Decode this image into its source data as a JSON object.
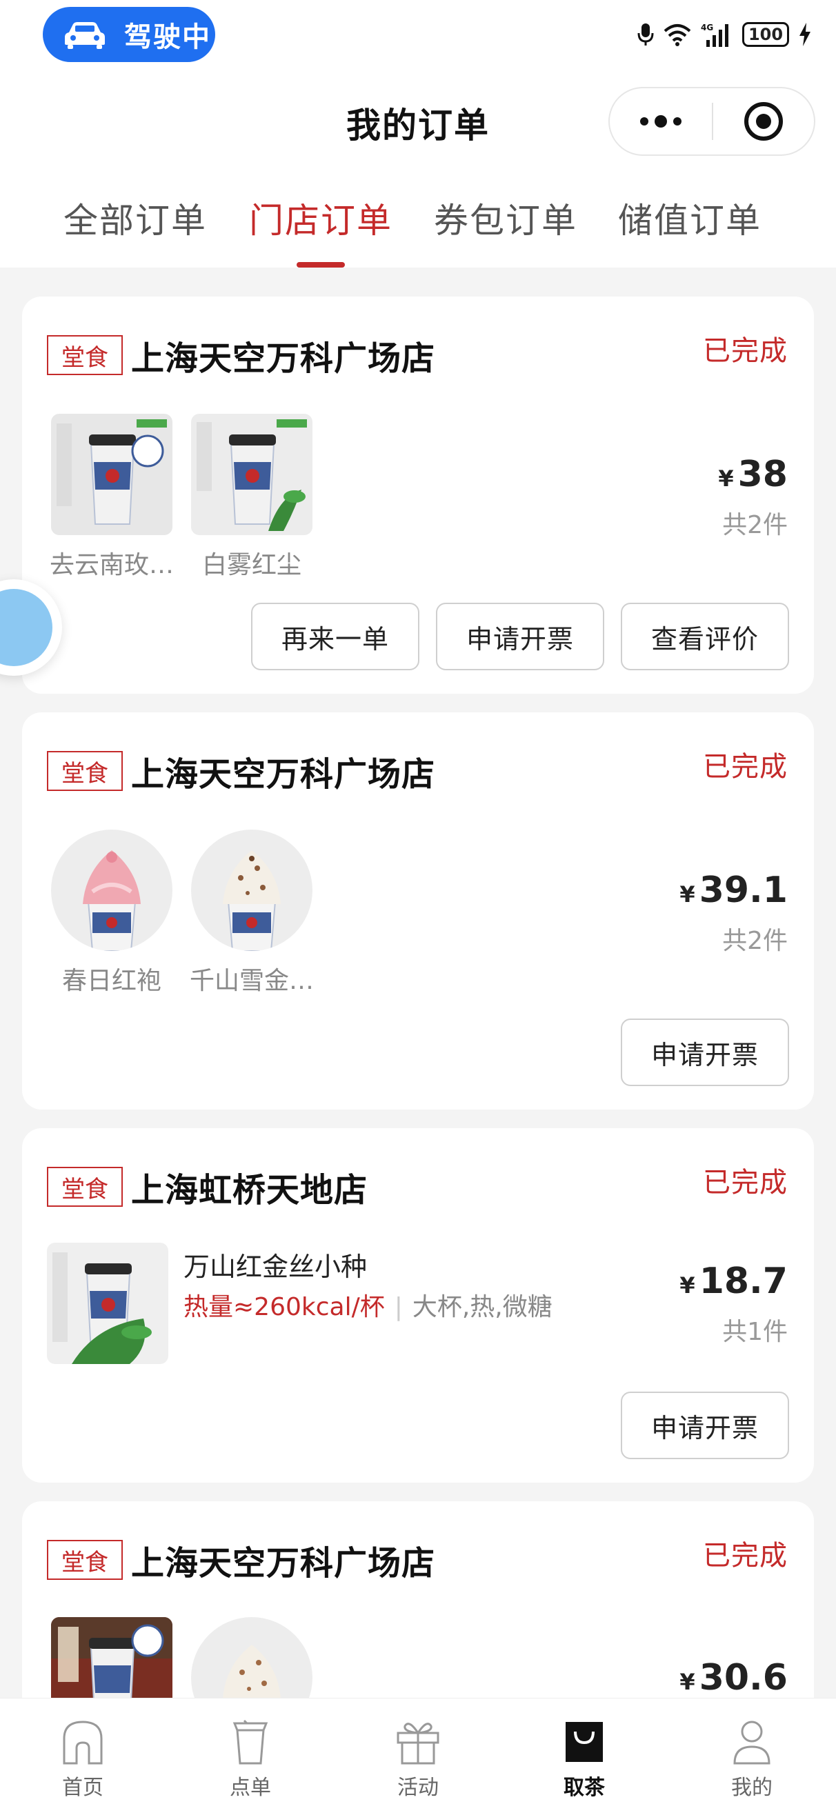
{
  "status_bar": {
    "driving_label": "驾驶中",
    "battery": "100",
    "network": "4G"
  },
  "header": {
    "title": "我的订单"
  },
  "tabs": [
    {
      "label": "全部订单"
    },
    {
      "label": "门店订单"
    },
    {
      "label": "券包订单"
    },
    {
      "label": "储值订单"
    }
  ],
  "active_tab": "门店订单",
  "orders": [
    {
      "tag": "堂食",
      "store": "上海天空万科广场店",
      "status": "已完成",
      "currency": "¥",
      "price": "38",
      "count": "共2件",
      "items": [
        {
          "label": "去云南玫…"
        },
        {
          "label": "白雾红尘"
        }
      ],
      "buttons": [
        {
          "label": "再来一单"
        },
        {
          "label": "申请开票"
        },
        {
          "label": "查看评价"
        }
      ]
    },
    {
      "tag": "堂食",
      "store": "上海天空万科广场店",
      "status": "已完成",
      "currency": "¥",
      "price": "39.1",
      "count": "共2件",
      "items": [
        {
          "label": "春日红袍"
        },
        {
          "label": "千山雪金…"
        }
      ],
      "buttons": [
        {
          "label": "申请开票"
        }
      ]
    },
    {
      "tag": "堂食",
      "store": "上海虹桥天地店",
      "status": "已完成",
      "currency": "¥",
      "price": "18.7",
      "count": "共1件",
      "item_name": "万山红金丝小种",
      "item_kcal": "热量≈260kcal/杯",
      "item_options": "大杯,热,微糖",
      "buttons": [
        {
          "label": "申请开票"
        }
      ]
    },
    {
      "tag": "堂食",
      "store": "上海天空万科广场店",
      "status": "已完成",
      "currency": "¥",
      "price": "30.6"
    }
  ],
  "bottom_nav": [
    {
      "label": "首页"
    },
    {
      "label": "点单"
    },
    {
      "label": "活动"
    },
    {
      "label": "取茶"
    },
    {
      "label": "我的"
    }
  ],
  "colors": {
    "accent": "#c42a2a",
    "drive_pill": "#1f6ff0",
    "background": "#f4f4f4"
  }
}
